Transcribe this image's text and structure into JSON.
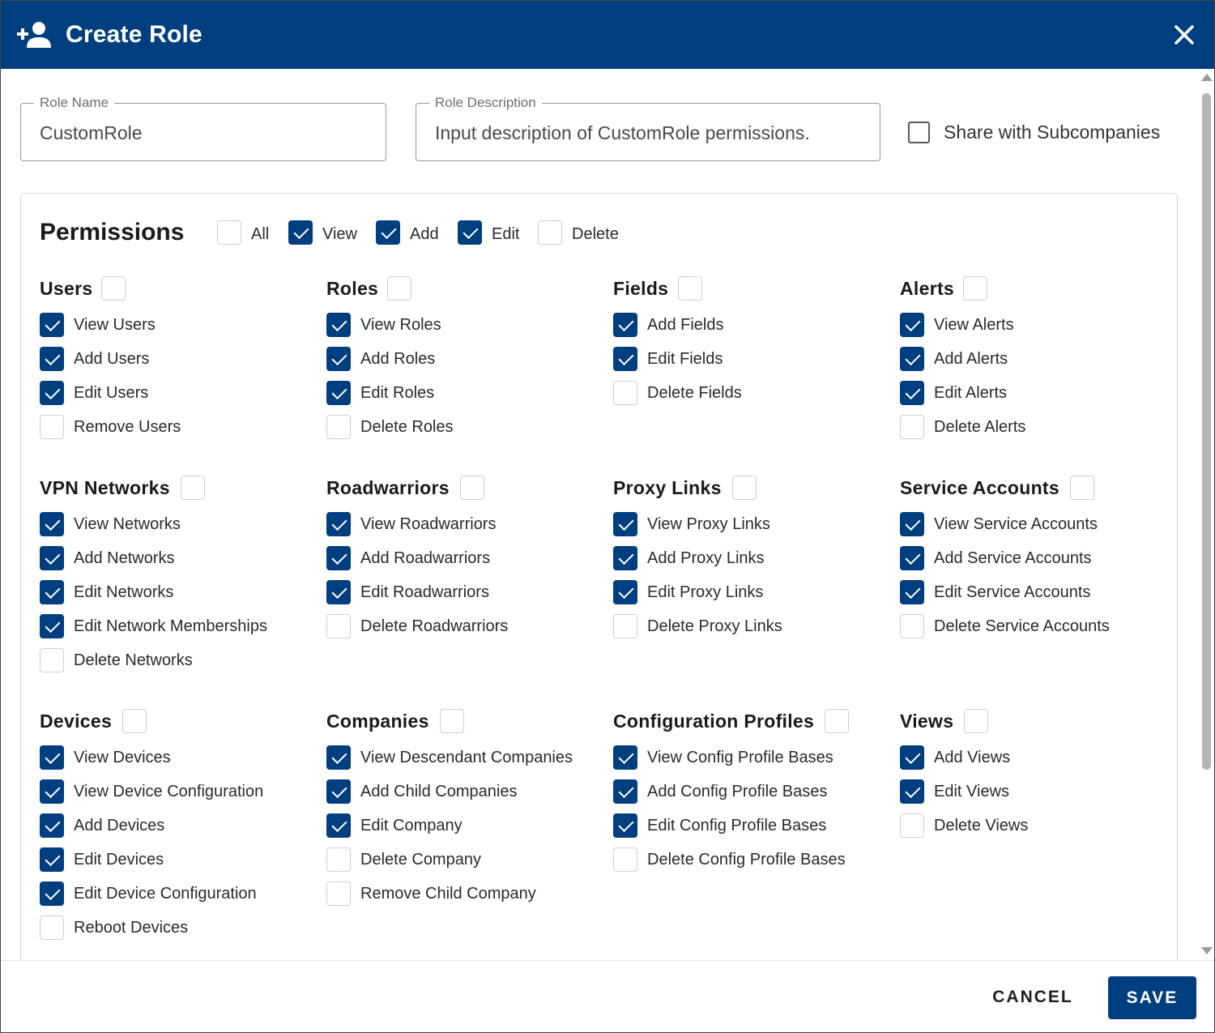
{
  "dialog": {
    "title": "Create Role",
    "title_icon": "person-add-icon",
    "close_icon": "close-icon"
  },
  "form": {
    "role_name": {
      "label": "Role Name",
      "value": "CustomRole"
    },
    "role_description": {
      "label": "Role Description",
      "value": "Input description of CustomRole permissions."
    },
    "share": {
      "label": "Share with Subcompanies",
      "checked": false
    }
  },
  "permissions": {
    "title": "Permissions",
    "filters": [
      {
        "label": "All",
        "checked": false
      },
      {
        "label": "View",
        "checked": true
      },
      {
        "label": "Add",
        "checked": true
      },
      {
        "label": "Edit",
        "checked": true
      },
      {
        "label": "Delete",
        "checked": false
      }
    ],
    "groups": [
      {
        "title": "Users",
        "checked": false,
        "items": [
          {
            "label": "View Users",
            "checked": true
          },
          {
            "label": "Add Users",
            "checked": true
          },
          {
            "label": "Edit Users",
            "checked": true
          },
          {
            "label": "Remove Users",
            "checked": false
          }
        ]
      },
      {
        "title": "Roles",
        "checked": false,
        "items": [
          {
            "label": "View Roles",
            "checked": true
          },
          {
            "label": "Add Roles",
            "checked": true
          },
          {
            "label": "Edit Roles",
            "checked": true
          },
          {
            "label": "Delete Roles",
            "checked": false
          }
        ]
      },
      {
        "title": "Fields",
        "checked": false,
        "items": [
          {
            "label": "Add Fields",
            "checked": true
          },
          {
            "label": "Edit Fields",
            "checked": true
          },
          {
            "label": "Delete Fields",
            "checked": false
          }
        ]
      },
      {
        "title": "Alerts",
        "checked": false,
        "items": [
          {
            "label": "View Alerts",
            "checked": true
          },
          {
            "label": "Add Alerts",
            "checked": true
          },
          {
            "label": "Edit Alerts",
            "checked": true
          },
          {
            "label": "Delete Alerts",
            "checked": false
          }
        ]
      },
      {
        "title": "VPN Networks",
        "checked": false,
        "items": [
          {
            "label": "View Networks",
            "checked": true
          },
          {
            "label": "Add Networks",
            "checked": true
          },
          {
            "label": "Edit Networks",
            "checked": true
          },
          {
            "label": "Edit Network Memberships",
            "checked": true
          },
          {
            "label": "Delete Networks",
            "checked": false
          }
        ]
      },
      {
        "title": "Roadwarriors",
        "checked": false,
        "items": [
          {
            "label": "View Roadwarriors",
            "checked": true
          },
          {
            "label": "Add Roadwarriors",
            "checked": true
          },
          {
            "label": "Edit Roadwarriors",
            "checked": true
          },
          {
            "label": "Delete Roadwarriors",
            "checked": false
          }
        ]
      },
      {
        "title": "Proxy Links",
        "checked": false,
        "items": [
          {
            "label": "View Proxy Links",
            "checked": true
          },
          {
            "label": "Add Proxy Links",
            "checked": true
          },
          {
            "label": "Edit Proxy Links",
            "checked": true
          },
          {
            "label": "Delete Proxy Links",
            "checked": false
          }
        ]
      },
      {
        "title": "Service Accounts",
        "checked": false,
        "items": [
          {
            "label": "View Service Accounts",
            "checked": true
          },
          {
            "label": "Add Service Accounts",
            "checked": true
          },
          {
            "label": "Edit Service Accounts",
            "checked": true
          },
          {
            "label": "Delete Service Accounts",
            "checked": false
          }
        ]
      },
      {
        "title": "Devices",
        "checked": false,
        "items": [
          {
            "label": "View Devices",
            "checked": true
          },
          {
            "label": "View Device Configuration",
            "checked": true
          },
          {
            "label": "Add Devices",
            "checked": true
          },
          {
            "label": "Edit Devices",
            "checked": true
          },
          {
            "label": "Edit Device Configuration",
            "checked": true
          },
          {
            "label": "Reboot Devices",
            "checked": false
          }
        ]
      },
      {
        "title": "Companies",
        "checked": false,
        "items": [
          {
            "label": "View Descendant Companies",
            "checked": true
          },
          {
            "label": "Add Child Companies",
            "checked": true
          },
          {
            "label": "Edit Company",
            "checked": true
          },
          {
            "label": "Delete Company",
            "checked": false
          },
          {
            "label": "Remove Child Company",
            "checked": false
          }
        ]
      },
      {
        "title": "Configuration Profiles",
        "checked": false,
        "items": [
          {
            "label": "View Config Profile Bases",
            "checked": true
          },
          {
            "label": "Add Config Profile Bases",
            "checked": true
          },
          {
            "label": "Edit Config Profile Bases",
            "checked": true
          },
          {
            "label": "Delete Config Profile Bases",
            "checked": false
          }
        ]
      },
      {
        "title": "Views",
        "checked": false,
        "items": [
          {
            "label": "Add Views",
            "checked": true
          },
          {
            "label": "Edit Views",
            "checked": true
          },
          {
            "label": "Delete Views",
            "checked": false
          }
        ]
      }
    ]
  },
  "footer": {
    "cancel_label": "CANCEL",
    "save_label": "SAVE"
  },
  "colors": {
    "primary": "#003f7f",
    "header_background": "#003f7f",
    "border": "#9a9a9a"
  }
}
